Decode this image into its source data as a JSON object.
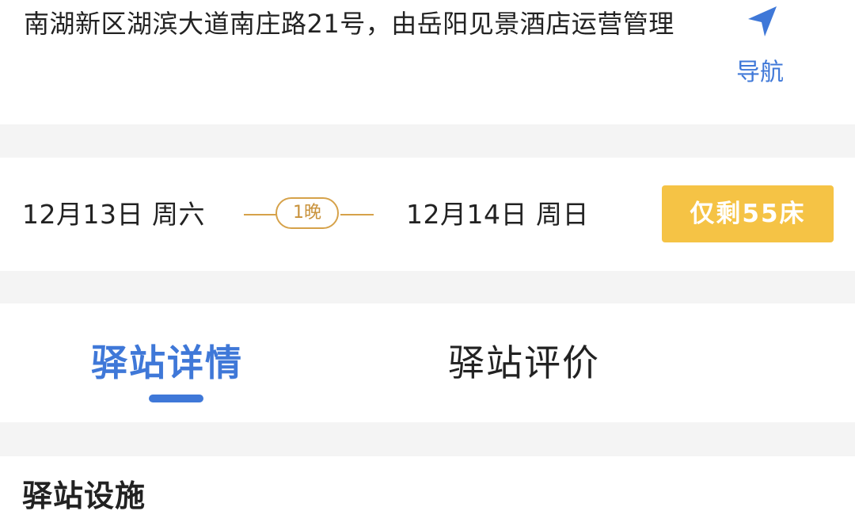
{
  "address": {
    "text": "南湖新区湖滨大道南庄路21号，由岳阳见景酒店运营管理"
  },
  "navigation": {
    "icon": "navigation-arrow-icon",
    "label": "导航",
    "color": "#3f78d8"
  },
  "stay": {
    "check_in": "12月13日 周六",
    "nights": "1晚",
    "check_out": "12月14日 周日",
    "availability": "仅剩55床",
    "accent": "#f5c345"
  },
  "tabs": [
    {
      "label": "驿站详情",
      "active": true
    },
    {
      "label": "驿站评价",
      "active": false
    }
  ],
  "facilities": {
    "title": "驿站设施"
  }
}
